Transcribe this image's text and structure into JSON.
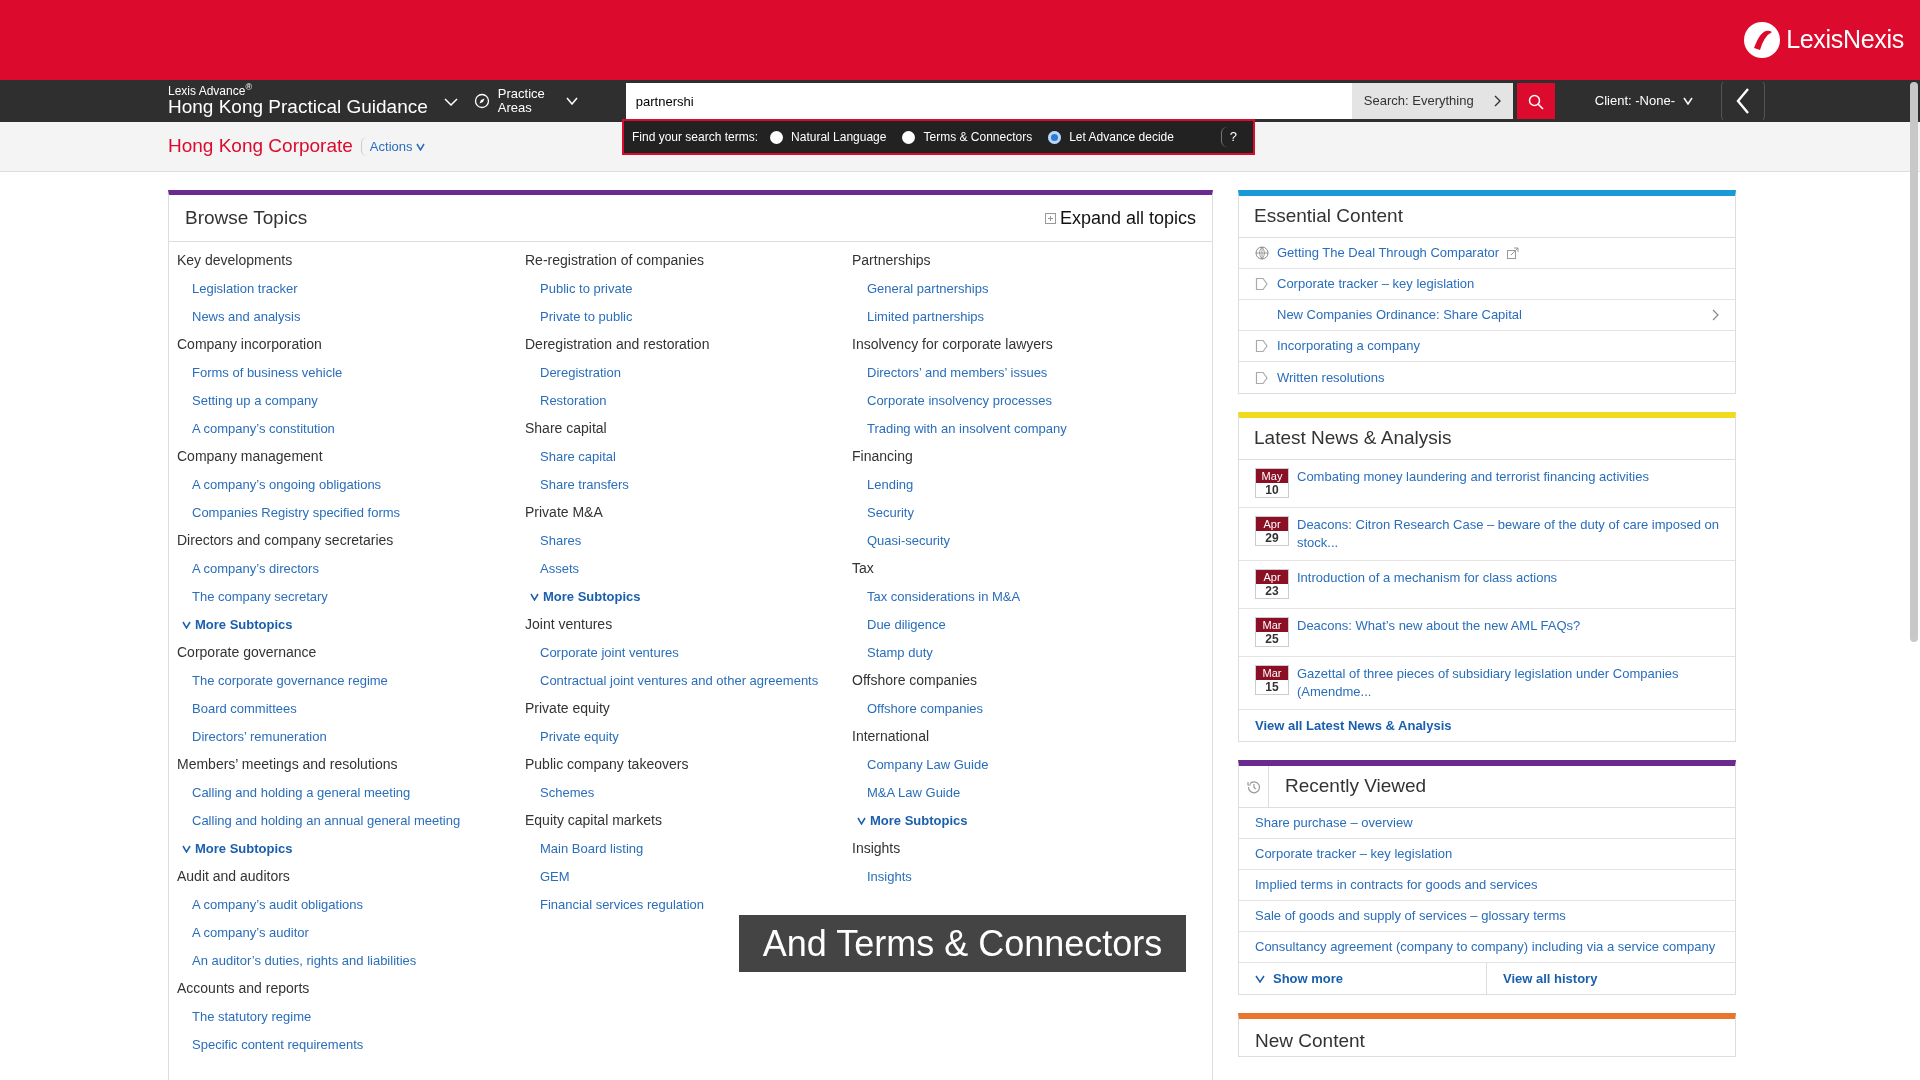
{
  "brand": {
    "logo": "LexisNexis"
  },
  "nav": {
    "product_line": "Lexis Advance$^{®}$",
    "product": "Hong Kong Practical Guidance",
    "practice_areas": "Practice Areas",
    "search_value": "partnershi",
    "search_scope": "Search: Everything",
    "client": "Client: -None-"
  },
  "search_options": {
    "label": "Find your search terms:",
    "help": "?",
    "options": [
      {
        "label": "Natural Language",
        "selected": false
      },
      {
        "label": "Terms & Connectors",
        "selected": false
      },
      {
        "label": "Let Advance decide",
        "selected": true
      }
    ]
  },
  "page_title": "Hong Kong Corporate",
  "actions": "Actions",
  "browse": {
    "title": "Browse Topics",
    "expand": "Expand all topics",
    "columns": [
      [
        {
          "kind": "heading",
          "text": "Key developments"
        },
        {
          "kind": "link",
          "text": "Legislation tracker"
        },
        {
          "kind": "link",
          "text": "News and analysis"
        },
        {
          "kind": "heading",
          "text": "Company incorporation"
        },
        {
          "kind": "link",
          "text": "Forms of business vehicle"
        },
        {
          "kind": "link",
          "text": "Setting up a company"
        },
        {
          "kind": "link",
          "text": "A company’s constitution"
        },
        {
          "kind": "heading",
          "text": "Company management"
        },
        {
          "kind": "link",
          "text": "A company’s ongoing obligations"
        },
        {
          "kind": "link",
          "text": "Companies Registry specified forms"
        },
        {
          "kind": "heading",
          "text": "Directors and company secretaries"
        },
        {
          "kind": "link",
          "text": "A company’s directors"
        },
        {
          "kind": "link",
          "text": "The company secretary"
        },
        {
          "kind": "more",
          "text": "More Subtopics"
        },
        {
          "kind": "heading",
          "text": "Corporate governance"
        },
        {
          "kind": "link",
          "text": "The corporate governance regime"
        },
        {
          "kind": "link",
          "text": "Board committees"
        },
        {
          "kind": "link",
          "text": "Directors’ remuneration"
        },
        {
          "kind": "heading",
          "text": "Members’ meetings and resolutions"
        },
        {
          "kind": "link",
          "text": "Calling and holding a general meeting"
        },
        {
          "kind": "link",
          "text": "Calling and holding an annual general meeting"
        },
        {
          "kind": "more",
          "text": "More Subtopics"
        },
        {
          "kind": "heading",
          "text": "Audit and auditors"
        },
        {
          "kind": "link",
          "text": "A company’s audit obligations"
        },
        {
          "kind": "link",
          "text": "A company’s auditor"
        },
        {
          "kind": "link",
          "text": "An auditor’s duties, rights and liabilities"
        },
        {
          "kind": "heading",
          "text": "Accounts and reports"
        },
        {
          "kind": "link",
          "text": "The statutory regime"
        },
        {
          "kind": "link",
          "text": "Specific content requirements"
        }
      ],
      [
        {
          "kind": "heading",
          "text": "Re-registration of companies"
        },
        {
          "kind": "link",
          "text": "Public to private"
        },
        {
          "kind": "link",
          "text": "Private to public"
        },
        {
          "kind": "heading",
          "text": "Deregistration and restoration"
        },
        {
          "kind": "link",
          "text": "Deregistration"
        },
        {
          "kind": "link",
          "text": "Restoration"
        },
        {
          "kind": "heading",
          "text": "Share capital"
        },
        {
          "kind": "link",
          "text": "Share capital"
        },
        {
          "kind": "link",
          "text": "Share transfers"
        },
        {
          "kind": "heading",
          "text": "Private M&A"
        },
        {
          "kind": "link",
          "text": "Shares"
        },
        {
          "kind": "link",
          "text": "Assets"
        },
        {
          "kind": "more",
          "text": "More Subtopics"
        },
        {
          "kind": "heading",
          "text": "Joint ventures"
        },
        {
          "kind": "link",
          "text": "Corporate joint ventures"
        },
        {
          "kind": "link",
          "text": "Contractual joint ventures and other agreements"
        },
        {
          "kind": "heading",
          "text": "Private equity"
        },
        {
          "kind": "link",
          "text": "Private equity"
        },
        {
          "kind": "heading",
          "text": "Public company takeovers"
        },
        {
          "kind": "link",
          "text": "Schemes"
        },
        {
          "kind": "heading",
          "text": "Equity capital markets"
        },
        {
          "kind": "link",
          "text": "Main Board listing"
        },
        {
          "kind": "link",
          "text": "GEM"
        },
        {
          "kind": "link",
          "text": "Financial services regulation"
        }
      ],
      [
        {
          "kind": "heading",
          "text": "Partnerships"
        },
        {
          "kind": "link",
          "text": "General partnerships"
        },
        {
          "kind": "link",
          "text": "Limited partnerships"
        },
        {
          "kind": "heading",
          "text": "Insolvency for corporate lawyers"
        },
        {
          "kind": "link",
          "text": "Directors’ and members’ issues"
        },
        {
          "kind": "link",
          "text": "Corporate insolvency processes"
        },
        {
          "kind": "link",
          "text": "Trading with an insolvent company"
        },
        {
          "kind": "heading",
          "text": "Financing"
        },
        {
          "kind": "link",
          "text": "Lending"
        },
        {
          "kind": "link",
          "text": "Security"
        },
        {
          "kind": "link",
          "text": "Quasi-security"
        },
        {
          "kind": "heading",
          "text": "Tax"
        },
        {
          "kind": "link",
          "text": "Tax considerations in M&A"
        },
        {
          "kind": "link",
          "text": "Due diligence"
        },
        {
          "kind": "link",
          "text": "Stamp duty"
        },
        {
          "kind": "heading",
          "text": "Offshore companies"
        },
        {
          "kind": "link",
          "text": "Offshore companies"
        },
        {
          "kind": "heading",
          "text": "International"
        },
        {
          "kind": "link",
          "text": "Company Law Guide"
        },
        {
          "kind": "link",
          "text": "M&A Law Guide"
        },
        {
          "kind": "more",
          "text": "More Subtopics"
        },
        {
          "kind": "heading",
          "text": "Insights"
        },
        {
          "kind": "link",
          "text": "Insights"
        }
      ]
    ]
  },
  "essential": {
    "title": "Essential Content",
    "items": [
      {
        "kind": "external",
        "text": "Getting The Deal Through Comparator"
      },
      {
        "kind": "document",
        "text": "Corporate tracker – key legislation"
      },
      {
        "kind": "submenu",
        "text": "New Companies Ordinance: Share Capital"
      },
      {
        "kind": "document",
        "text": "Incorporating a company"
      },
      {
        "kind": "document",
        "text": "Written resolutions"
      }
    ]
  },
  "news": {
    "title": "Latest News & Analysis",
    "view_all": "View all Latest News & Analysis",
    "items": [
      {
        "month": "May",
        "day": "10",
        "text": "Combating money laundering and terrorist financing activities"
      },
      {
        "month": "Apr",
        "day": "29",
        "text": "Deacons: Citron Research Case – beware of the duty of care imposed on stock..."
      },
      {
        "month": "Apr",
        "day": "23",
        "text": "Introduction of a mechanism for class actions"
      },
      {
        "month": "Mar",
        "day": "25",
        "text": "Deacons: What’s new about the new AML FAQs?"
      },
      {
        "month": "Mar",
        "day": "15",
        "text": "Gazettal of three pieces of subsidiary legislation under Companies (Amendme..."
      }
    ]
  },
  "recent": {
    "title": "Recently Viewed",
    "show_more": "Show more",
    "view_all": "View all history",
    "items": [
      "Share purchase – overview",
      "Corporate tracker – key legislation",
      "Implied terms in contracts for goods and services",
      "Sale of goods and supply of services – glossary terms",
      "Consultancy agreement (company to company) including via a service company"
    ]
  },
  "new_content": {
    "title": "New Content"
  },
  "caption": "And Terms & Connectors"
}
